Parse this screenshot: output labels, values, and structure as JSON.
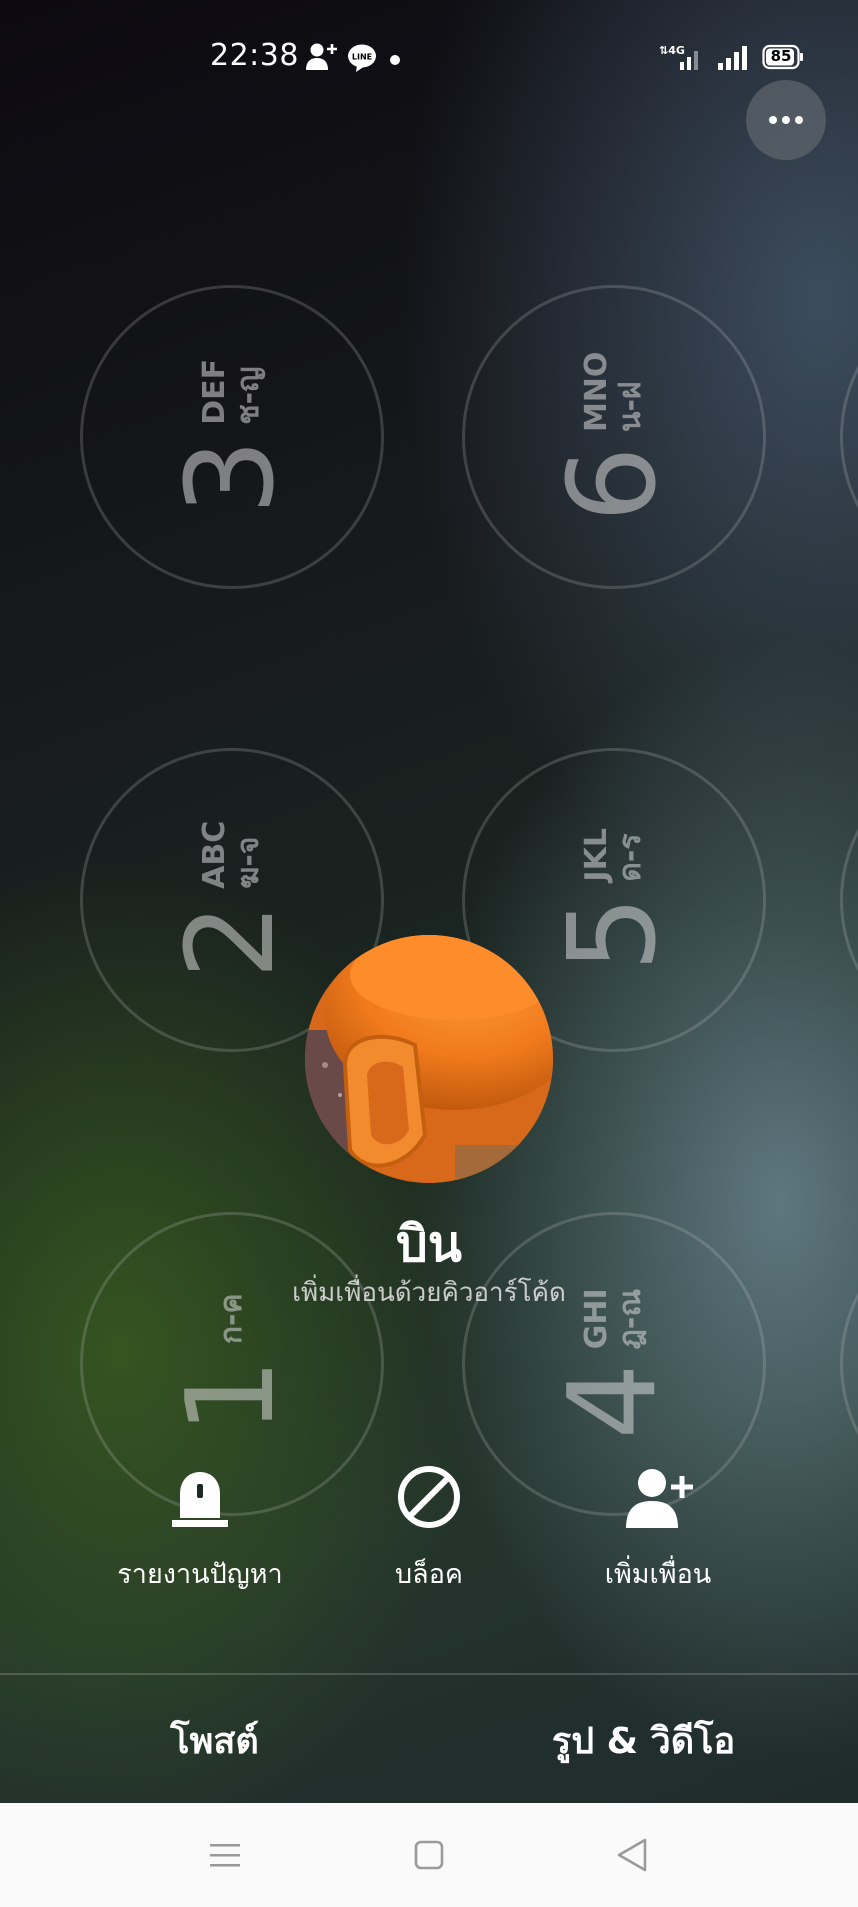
{
  "status_bar": {
    "time": "22:38",
    "network": "4G",
    "battery": "85",
    "icons": [
      "add-friend-notification-icon",
      "line-app-icon",
      "dot-icon",
      "4g-signal-icon",
      "cell-signal-icon",
      "battery-icon"
    ]
  },
  "keypad": {
    "keys": [
      {
        "digit": "3",
        "letters": "DEF",
        "thai": "ช-ญ"
      },
      {
        "digit": "6",
        "letters": "MNO",
        "thai": "น-ฝ"
      },
      {
        "digit": "2",
        "letters": "ABC",
        "thai": "ฆ-จ"
      },
      {
        "digit": "5",
        "letters": "JKL",
        "thai": "ด-ร"
      },
      {
        "digit": "1",
        "letters": "",
        "thai": "ก-ค"
      },
      {
        "digit": "4",
        "letters": "GHI",
        "thai": "ฎ-ณ"
      }
    ]
  },
  "profile": {
    "name": "บิน",
    "subtitle": "เพิ่มเพื่อนด้วยคิวอาร์โค้ด"
  },
  "actions": {
    "report": "รายงานปัญหา",
    "block": "บล็อค",
    "add_friend": "เพิ่มเพื่อน"
  },
  "tabs": {
    "posts": "โพสต์",
    "photos_videos": "รูป & วิดีโอ"
  },
  "colors": {
    "text": "#ffffff",
    "nav_bar": "#fafafa",
    "nav_icon": "#9a9a9a",
    "avatar_orange": "#f07a1c"
  }
}
